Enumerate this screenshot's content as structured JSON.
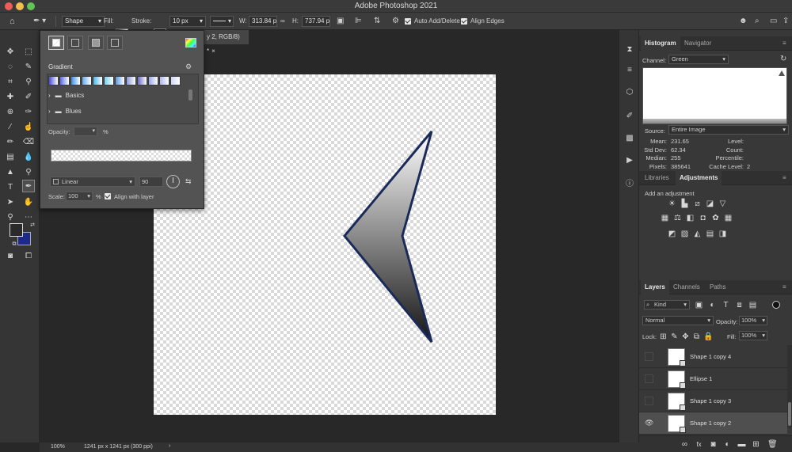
{
  "window": {
    "title": "Adobe Photoshop 2021"
  },
  "options_bar": {
    "mode": "Shape",
    "fill_label": "Fill:",
    "stroke_label": "Stroke:",
    "stroke_size": "10 px",
    "w_label": "W:",
    "w_value": "313.84 p",
    "h_label": "H:",
    "h_value": "737.94 p",
    "auto_add_delete": "Auto Add/Delete",
    "align_edges": "Align Edges"
  },
  "document": {
    "tab_title": "y 2, RGB/8) *",
    "zoom": "100%",
    "info": "1241 px x 1241 px (300 ppi)"
  },
  "gradient_popup": {
    "section_label": "Gradient",
    "folders": [
      "Basics",
      "Blues"
    ],
    "opacity_label": "Opacity:",
    "opacity_unit": "%",
    "style": "Linear",
    "angle": "90",
    "scale_label": "Scale:",
    "scale_value": "100",
    "scale_unit": "%",
    "align_with_layer": "Align with layer",
    "swatch_colors": [
      "#4a4ad8",
      "#5a6ae8",
      "#3c8ce8",
      "#6aa8f0",
      "#4ab8e8",
      "#7ad0f0",
      "#5a98e0",
      "#8a9ad8",
      "#6a6ac8",
      "#9aa8e8",
      "#b0b8f0",
      "#d0d8f8"
    ]
  },
  "histogram_panel": {
    "tabs": [
      "Histogram",
      "Navigator"
    ],
    "channel_label": "Channel:",
    "channel_value": "Green",
    "source_label": "Source:",
    "source_value": "Entire Image",
    "stats_left": [
      {
        "label": "Mean:",
        "value": "231.65"
      },
      {
        "label": "Std Dev:",
        "value": "62.34"
      },
      {
        "label": "Median:",
        "value": "255"
      },
      {
        "label": "Pixels:",
        "value": "385641"
      }
    ],
    "stats_right": [
      {
        "label": "Level:",
        "value": ""
      },
      {
        "label": "Count:",
        "value": ""
      },
      {
        "label": "Percentile:",
        "value": ""
      },
      {
        "label": "Cache Level:",
        "value": "2"
      }
    ]
  },
  "adjustments_panel": {
    "tabs": [
      "Libraries",
      "Adjustments"
    ],
    "hint": "Add an adjustment"
  },
  "layers_panel": {
    "tabs": [
      "Layers",
      "Channels",
      "Paths"
    ],
    "filter_kind": "Kind",
    "blend_mode": "Normal",
    "opacity_label": "Opacity:",
    "opacity_value": "100%",
    "lock_label": "Lock:",
    "fill_label": "Fill:",
    "fill_value": "100%",
    "layers": [
      {
        "name": "Shape 1 copy 4",
        "visible": false,
        "selected": false
      },
      {
        "name": "Ellipse 1",
        "visible": false,
        "selected": false
      },
      {
        "name": "Shape 1 copy 3",
        "visible": false,
        "selected": false
      },
      {
        "name": "Shape 1 copy 2",
        "visible": true,
        "selected": true
      }
    ]
  },
  "colors": {
    "foreground": "#2a2a2a",
    "background": "#1c2a8a",
    "shape_stroke": "#1a2a5a"
  }
}
